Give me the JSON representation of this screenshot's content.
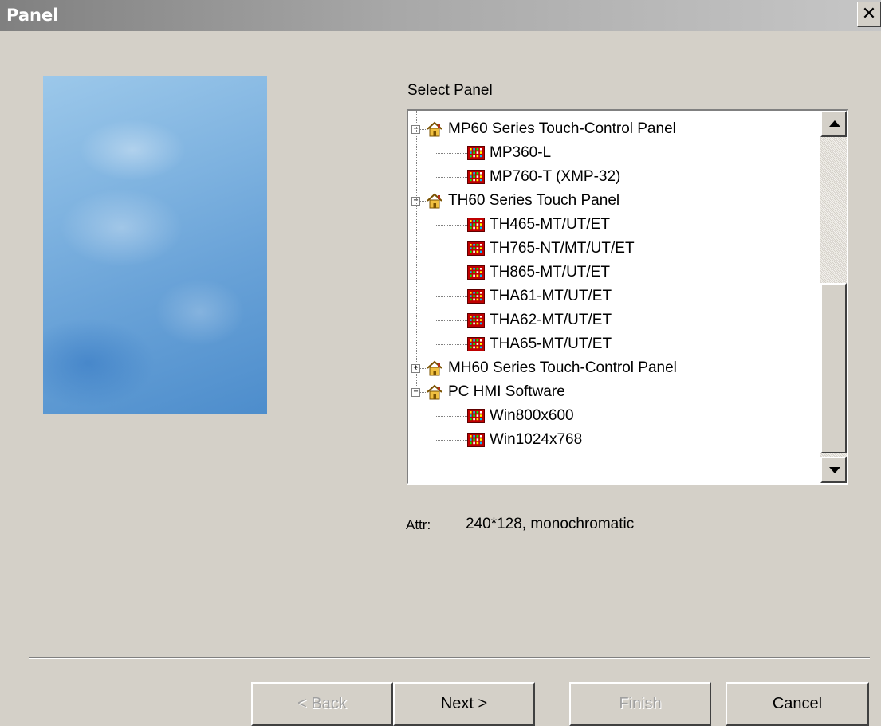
{
  "window": {
    "title": "Panel",
    "close_glyph": "✕"
  },
  "tree": {
    "label": "Select Panel",
    "groups": [
      {
        "label": "MP60 Series Touch-Control Panel",
        "expander": "−",
        "icon": "house-icon",
        "children": [
          "MP360-L",
          "MP760-T (XMP-32)"
        ]
      },
      {
        "label": "TH60 Series Touch Panel",
        "expander": "−",
        "icon": "house-icon",
        "children": [
          "TH465-MT/UT/ET",
          "TH765-NT/MT/UT/ET",
          "TH865-MT/UT/ET",
          "THA61-MT/UT/ET",
          "THA62-MT/UT/ET",
          "THA65-MT/UT/ET"
        ]
      },
      {
        "label": "MH60 Series Touch-Control Panel",
        "expander": "+",
        "icon": "house-icon",
        "children": []
      },
      {
        "label": "PC HMI Software",
        "expander": "−",
        "icon": "house-icon",
        "children": [
          "Win800x600",
          "Win1024x768"
        ]
      }
    ],
    "child_icon": "panel-icon"
  },
  "attr": {
    "label": "Attr:",
    "value": "240*128, monochromatic"
  },
  "buttons": {
    "back": "< Back",
    "next": "Next >",
    "finish": "Finish",
    "cancel": "Cancel"
  }
}
